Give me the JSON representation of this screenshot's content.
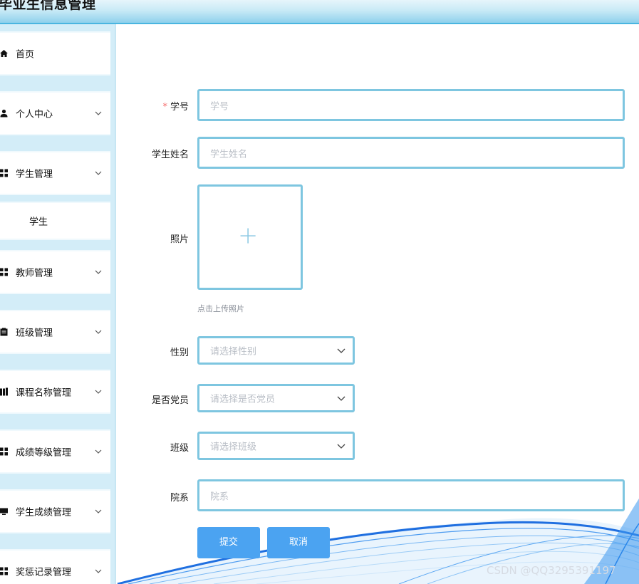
{
  "header": {
    "title": "毕业生信息管理"
  },
  "sidebar": {
    "items": [
      {
        "label": "首页",
        "icon": "home-icon",
        "has_arrow": false
      },
      {
        "label": "个人中心",
        "icon": "user-icon",
        "has_arrow": true
      },
      {
        "label": "学生管理",
        "icon": "grid-icon",
        "has_arrow": true
      },
      {
        "label": "学生",
        "icon": "",
        "has_arrow": false
      },
      {
        "label": "教师管理",
        "icon": "grid-icon",
        "has_arrow": true
      },
      {
        "label": "班级管理",
        "icon": "clipboard-icon",
        "has_arrow": true
      },
      {
        "label": "课程名称管理",
        "icon": "book-icon",
        "has_arrow": true
      },
      {
        "label": "成绩等级管理",
        "icon": "grid-icon",
        "has_arrow": true
      },
      {
        "label": "学生成绩管理",
        "icon": "monitor-icon",
        "has_arrow": true
      },
      {
        "label": "奖惩记录管理",
        "icon": "grid-icon",
        "has_arrow": true
      }
    ]
  },
  "form": {
    "student_id": {
      "label": "学号",
      "required_mark": "*",
      "placeholder": "学号"
    },
    "student_name": {
      "label": "学生姓名",
      "placeholder": "学生姓名"
    },
    "photo": {
      "label": "照片",
      "upload_tip": "点击上传照片"
    },
    "gender": {
      "label": "性别",
      "placeholder": "请选择性别"
    },
    "party_member": {
      "label": "是否党员",
      "placeholder": "请选择是否党员"
    },
    "class": {
      "label": "班级",
      "placeholder": "请选择班级"
    },
    "department": {
      "label": "院系",
      "placeholder": "院系"
    }
  },
  "buttons": {
    "submit": "提交",
    "cancel": "取消"
  },
  "watermark": "CSDN @QQ3295391197",
  "colors": {
    "accent": "#4ba3f1",
    "input_border": "#7ec6e0",
    "sidebar_bg": "#d3edf8",
    "required": "#f56c6c"
  }
}
